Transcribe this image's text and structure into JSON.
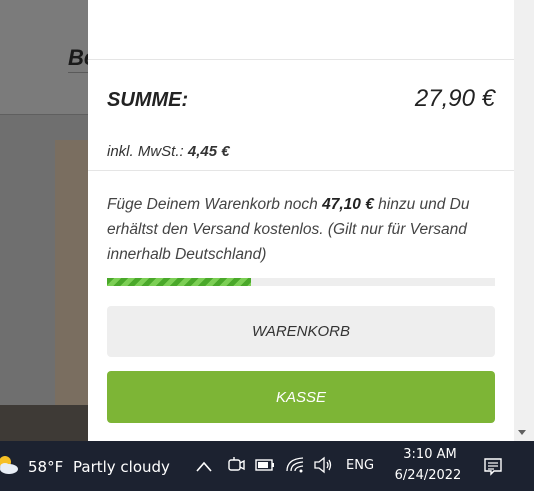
{
  "background": {
    "heading_fragment": "Be"
  },
  "cart": {
    "sum_label": "SUMME:",
    "sum_value": "27,90 €",
    "vat_label": "inkl. MwSt.:",
    "vat_value": "4,45 €",
    "shipping_message": {
      "before": "Füge Deinem Warenkorb noch ",
      "amount": "47,10 €",
      "after": " hinzu und Du erhältst den Versand kostenlos. (Gilt nur für Versand innerhalb Deutschland)"
    },
    "shipping_progress_percent": 37,
    "cart_button_label": "WARENKORB",
    "checkout_button_label": "KASSE",
    "colors": {
      "checkout": "#7db536",
      "progress": "#4aa82a"
    }
  },
  "taskbar": {
    "weather_icon": "partly-cloudy-icon",
    "temperature": "58°F",
    "weather": "Partly cloudy",
    "tray_icons": [
      "chevron-up-icon",
      "meet-now-icon",
      "battery-icon",
      "wifi-icon",
      "volume-icon"
    ],
    "language": "ENG",
    "time": "3:10 AM",
    "date": "6/24/2022",
    "notification_icon": "notifications-icon"
  }
}
